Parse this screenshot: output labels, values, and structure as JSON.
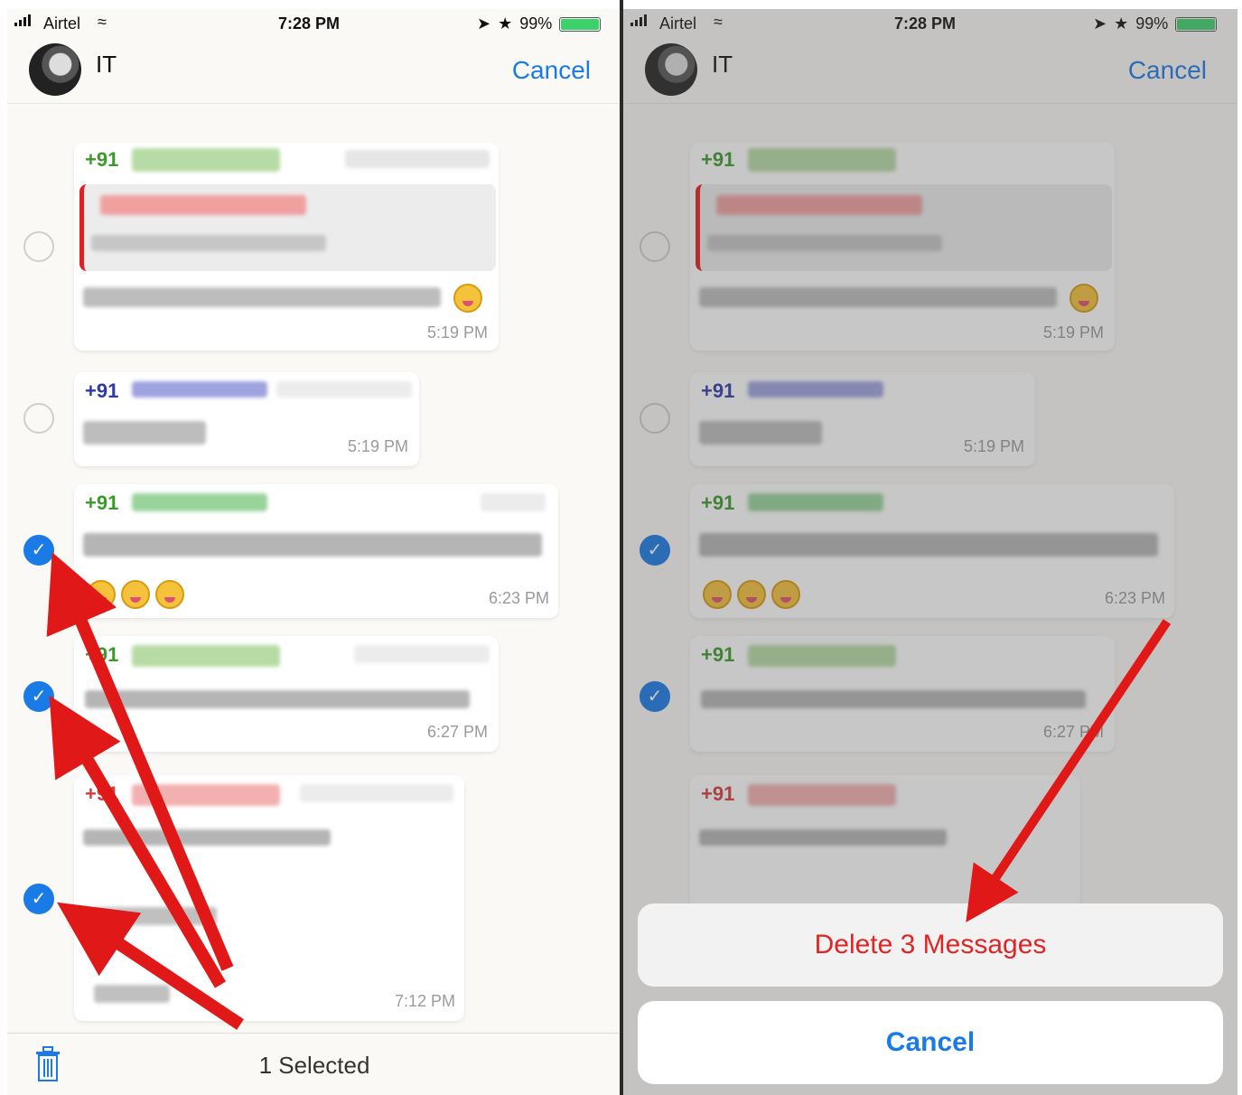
{
  "status_bar": {
    "carrier": "Airtel",
    "time": "7:28 PM",
    "battery": "99%",
    "battery_level": 0.99
  },
  "header": {
    "chat_name": "IT",
    "cancel_label": "Cancel"
  },
  "messages": [
    {
      "sender": "+91",
      "time": "5:19 PM"
    },
    {
      "sender": "+91",
      "time": "5:19 PM"
    },
    {
      "sender": "+91",
      "time": "6:23 PM"
    },
    {
      "sender": "+91",
      "time": "6:27 PM"
    },
    {
      "sender": "+91",
      "time": "7:12 PM"
    }
  ],
  "toolbar": {
    "selected_label": "1 Selected",
    "trash_icon": "trash-icon"
  },
  "action_sheet": {
    "delete_label": "Delete 3 Messages",
    "cancel_label": "Cancel"
  },
  "colors": {
    "accent": "#1a7ae6",
    "delete": "#e02525",
    "sender_green": "#3a9a2a",
    "sender_blue": "#2b3aa8",
    "sender_red": "#d83a3a",
    "arrow": "#e01818"
  }
}
